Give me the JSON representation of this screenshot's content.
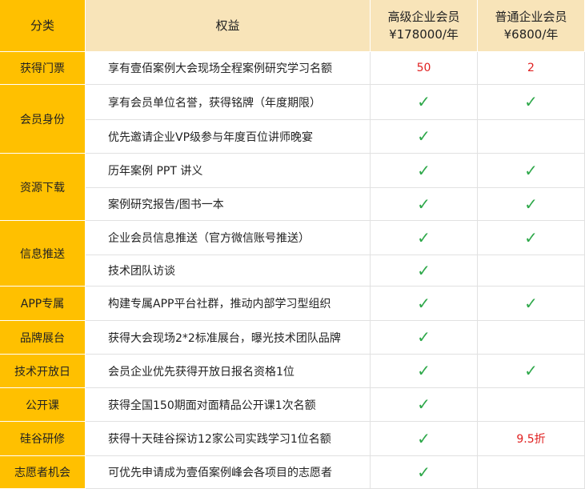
{
  "header": {
    "category": "分类",
    "benefit": "权益",
    "premium": {
      "name": "高级企业会员",
      "price": "¥178000/年"
    },
    "standard": {
      "name": "普通企业会员",
      "price": "¥6800/年"
    }
  },
  "rows": [
    {
      "category": "获得门票",
      "span": 1,
      "benefit": "享有壹佰案例大会现场全程案例研究学习名额",
      "premium": "50",
      "standard": "2",
      "h": 41
    },
    {
      "category": "会员身份",
      "span": 2,
      "benefit": "享有会员单位名誉，获得铭牌（年度期限）",
      "premium": "✓",
      "standard": "✓",
      "h": 44
    },
    {
      "category": "",
      "span": 0,
      "benefit": "优先邀请企业VP级参与年度百位讲师晚宴",
      "premium": "✓",
      "standard": "",
      "h": 42
    },
    {
      "category": "资源下载",
      "span": 2,
      "benefit": "历年案例 PPT 讲义",
      "premium": "✓",
      "standard": "✓",
      "h": 43
    },
    {
      "category": "",
      "span": 0,
      "benefit": "案例研究报告/图书一本",
      "premium": "✓",
      "standard": "✓",
      "h": 41
    },
    {
      "category": "信息推送",
      "span": 2,
      "benefit": "企业会员信息推送（官方微信账号推送）",
      "premium": "✓",
      "standard": "✓",
      "h": 43
    },
    {
      "category": "",
      "span": 0,
      "benefit": "技术团队访谈",
      "premium": "✓",
      "standard": "",
      "h": 39
    },
    {
      "category": "APP专属",
      "span": 1,
      "benefit": "构建专属APP平台社群，推动内部学习型组织",
      "premium": "✓",
      "standard": "✓",
      "h": 43
    },
    {
      "category": "品牌展台",
      "span": 1,
      "benefit": "获得大会现场2*2标准展台，曝光技术团队品牌",
      "premium": "✓",
      "standard": "",
      "h": 42
    },
    {
      "category": "技术开放日",
      "span": 1,
      "benefit": "会员企业优先获得开放日报名资格1位",
      "premium": "✓",
      "standard": "✓",
      "h": 42
    },
    {
      "category": "公开课",
      "span": 1,
      "benefit": "获得全国150期面对面精品公开课1次名额",
      "premium": "✓",
      "standard": "",
      "h": 42
    },
    {
      "category": "硅谷研修",
      "span": 1,
      "benefit": "获得十天硅谷探访12家公司实践学习1位名额",
      "premium": "✓",
      "standard": "9.5折",
      "h": 43
    },
    {
      "category": "志愿者机会",
      "span": 1,
      "benefit": "可优先申请成为壹佰案例峰会各项目的志愿者",
      "premium": "✓",
      "standard": "",
      "h": 41
    }
  ]
}
